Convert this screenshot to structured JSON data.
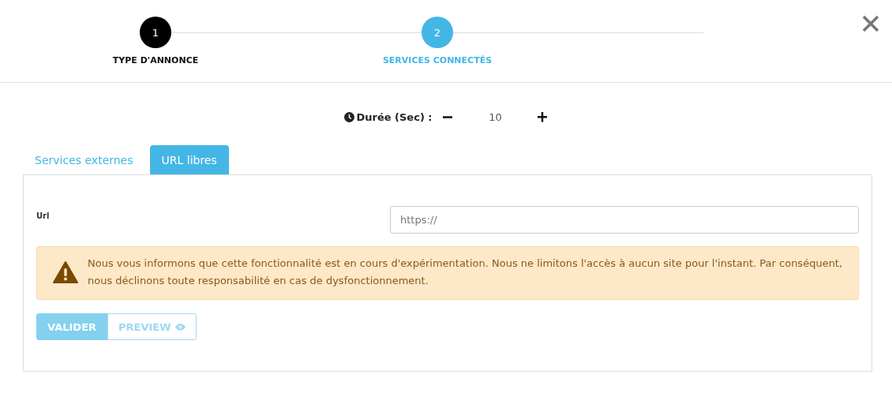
{
  "steps": [
    {
      "number": "1",
      "label": "TYPE D'ANNONCE",
      "completed": true,
      "selected": false
    },
    {
      "number": "2",
      "label": "SERVICES CONNECTÉS",
      "completed": false,
      "selected": true
    }
  ],
  "duration": {
    "label": "Durée (Sec) :",
    "value": "10"
  },
  "tabs": [
    {
      "label": "Services externes",
      "selected": false
    },
    {
      "label": "URL libres",
      "selected": true
    }
  ],
  "url_field": {
    "label": "Url",
    "placeholder": "https://"
  },
  "alert": {
    "text": "Nous vous informons que cette fonctionnalité est en cours d'expérimentation. Nous ne limitons l'accès à aucun site pour l'instant. Par conséquent, nous déclinons toute responsabilité en cas de dysfonctionnement."
  },
  "buttons": [
    {
      "label": "VALIDER",
      "kind": "primary",
      "disabled": true
    },
    {
      "label": "PREVIEW",
      "kind": "preview",
      "disabled": true
    }
  ]
}
